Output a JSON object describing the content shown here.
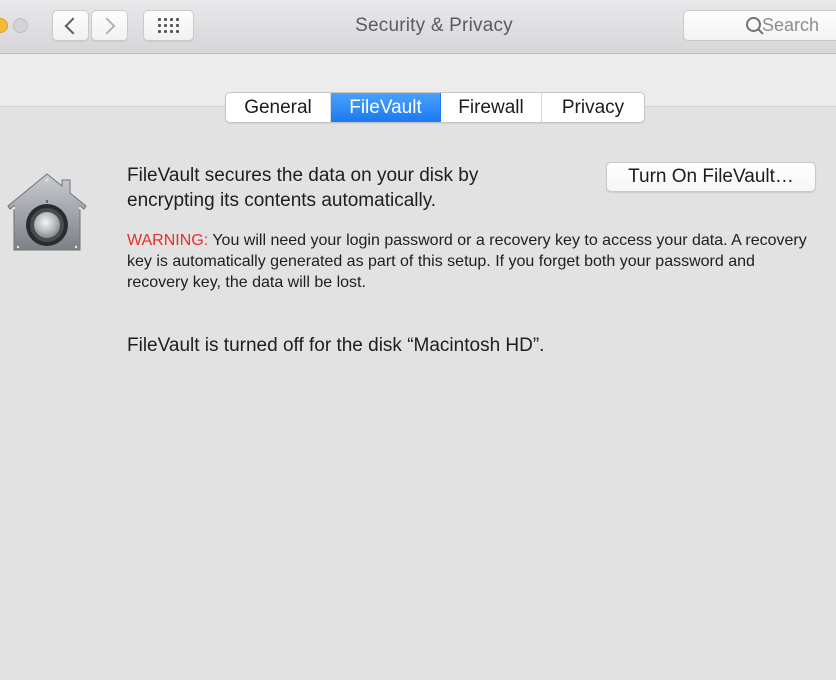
{
  "window": {
    "title": "Security & Privacy",
    "search_placeholder": "Search"
  },
  "toolbar": {
    "back_icon": "chevron-left-icon",
    "forward_icon": "chevron-right-icon",
    "show_all_icon": "grid-icon",
    "search_icon": "magnifier-icon"
  },
  "tabs": [
    {
      "label": "General",
      "active": false
    },
    {
      "label": "FileVault",
      "active": true
    },
    {
      "label": "Firewall",
      "active": false
    },
    {
      "label": "Privacy",
      "active": false
    }
  ],
  "filevault": {
    "icon": "filevault-house-safe-icon",
    "intro": "FileVault secures the data on your disk by encrypting its contents automatically.",
    "turn_on_button": "Turn On FileVault…",
    "warning_label": "WARNING:",
    "warning_text": " You will need your login password or a recovery key to access your data. A recovery key is automatically generated as part of this setup. If you forget both your password and recovery key, the data will be lost.",
    "status": "FileVault is turned off for the disk “Macintosh HD”."
  },
  "colors": {
    "accent": "#1b79f1",
    "warning": "#e2302b",
    "background": "#e2e2e3"
  }
}
